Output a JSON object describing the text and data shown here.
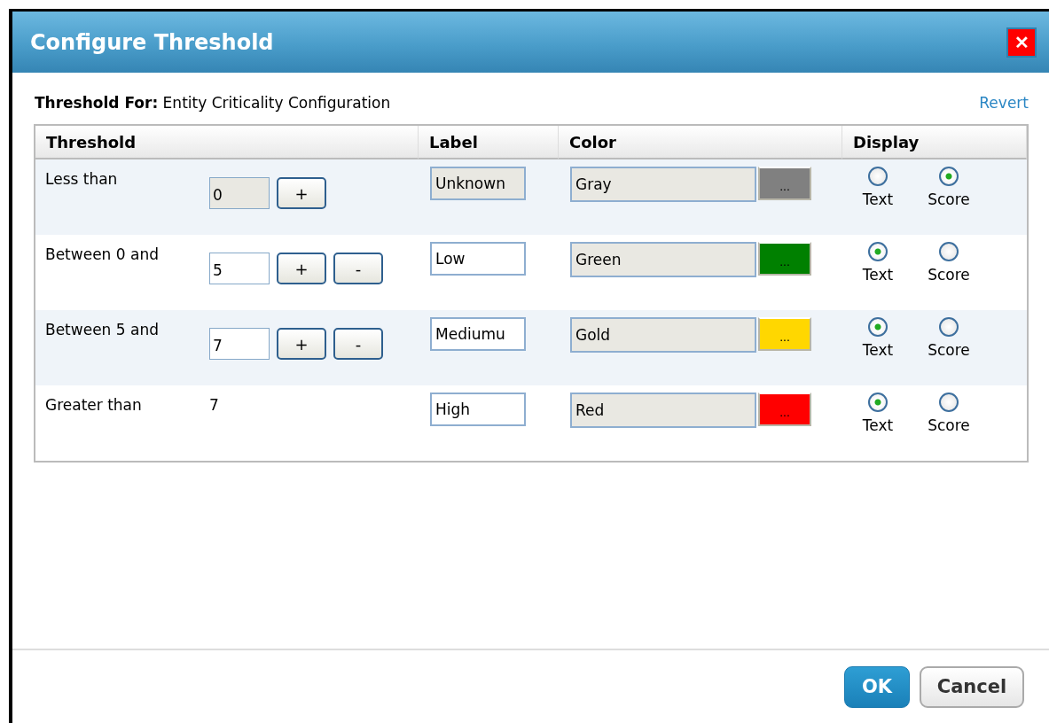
{
  "window": {
    "title": "Configure Threshold",
    "close": "✕"
  },
  "threshold_for": {
    "label": "Threshold For:",
    "value": "Entity Criticality Configuration"
  },
  "revert_link": "Revert",
  "table": {
    "columns": [
      "Threshold",
      "Label",
      "Color",
      "Display"
    ],
    "rows": [
      {
        "condition": "Less than",
        "kind": "field",
        "value": "0",
        "value_disabled": true,
        "buttons": [
          "+"
        ],
        "label": "Unknown",
        "label_disabled": true,
        "color_name": "Gray",
        "color": "#808080",
        "swatch_text": "...",
        "display": [
          {
            "label": "Text",
            "selected": false
          },
          {
            "label": "Score",
            "selected": true
          }
        ]
      },
      {
        "condition": "Between 0 and",
        "kind": "field",
        "value": "5",
        "value_disabled": false,
        "buttons": [
          "+",
          "-"
        ],
        "label": "Low",
        "label_disabled": false,
        "color_name": "Green",
        "color": "#008000",
        "swatch_text": "...",
        "display": [
          {
            "label": "Text",
            "selected": true
          },
          {
            "label": "Score",
            "selected": false
          }
        ]
      },
      {
        "condition": "Between 5 and",
        "kind": "field",
        "value": "7",
        "value_disabled": false,
        "buttons": [
          "+",
          "-"
        ],
        "label": "Mediumu",
        "label_disabled": false,
        "color_name": "Gold",
        "color": "#ffd700",
        "swatch_text": "...",
        "display": [
          {
            "label": "Text",
            "selected": true
          },
          {
            "label": "Score",
            "selected": false
          }
        ]
      },
      {
        "condition": "Greater than",
        "kind": "text",
        "value": "7",
        "buttons": [],
        "label": "High",
        "label_disabled": false,
        "color_name": "Red",
        "color": "#ff0000",
        "swatch_text": "...",
        "display": [
          {
            "label": "Text",
            "selected": true
          },
          {
            "label": "Score",
            "selected": false
          }
        ]
      }
    ]
  },
  "buttons": [
    {
      "label": "OK",
      "kind": "primary"
    },
    {
      "label": "Cancel",
      "kind": "secondary"
    }
  ]
}
